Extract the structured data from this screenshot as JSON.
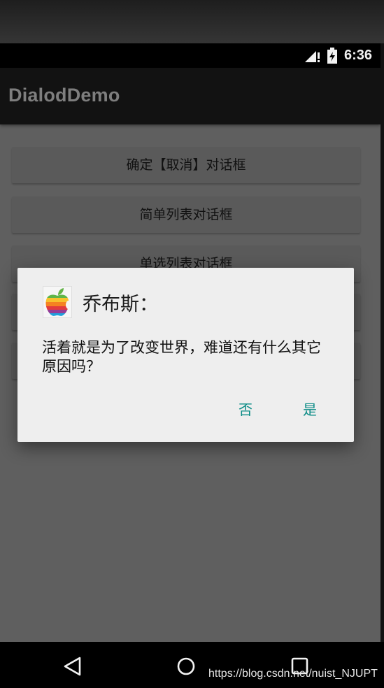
{
  "status_bar": {
    "time": "6:36"
  },
  "app": {
    "title": "DialodDemo",
    "buttons": [
      "确定【取消】对话框",
      "简单列表对话框",
      "单选列表对话框"
    ]
  },
  "dialog": {
    "title": "乔布斯：",
    "message": "活着就是为了改变世界，难道还有什么其它原因吗？",
    "negative_button": "否",
    "positive_button": "是",
    "icon": "apple-logo-icon"
  },
  "nav": {
    "icons": [
      "back-icon",
      "home-icon",
      "recents-icon"
    ]
  },
  "watermark": "https://blog.csdn.net/nuist_NJUPT",
  "colors": {
    "accent": "#0b8c86",
    "dialog_bg": "#eeeeee",
    "dim_overlay": "#5f5f5f"
  }
}
